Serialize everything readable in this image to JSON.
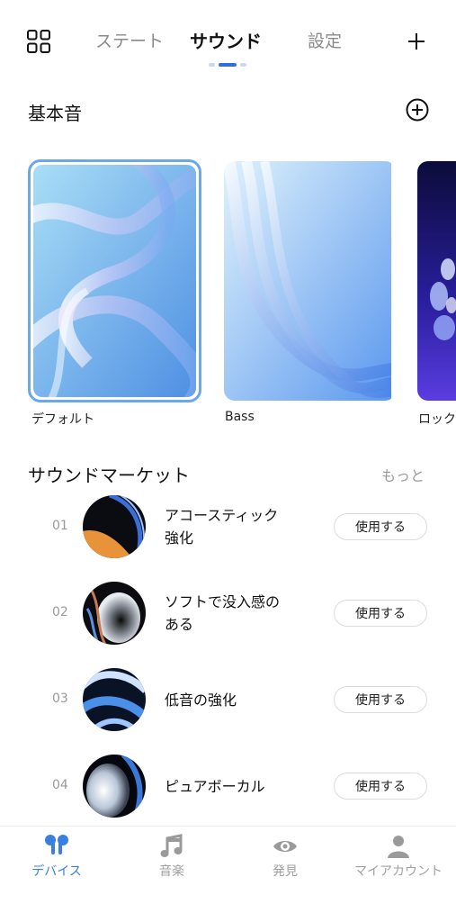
{
  "top_bar": {
    "tabs": [
      {
        "label": "ステート"
      },
      {
        "label": "サウンド"
      },
      {
        "label": "設定"
      }
    ]
  },
  "basic_sound": {
    "title": "基本音",
    "cards": [
      {
        "label": "デフォルト"
      },
      {
        "label": "Bass"
      },
      {
        "label": "ロック"
      }
    ]
  },
  "market": {
    "title": "サウンドマーケット",
    "more": "もっと",
    "items": [
      {
        "num": "01",
        "title_line1": "アコースティック",
        "title_line2": "強化",
        "button": "使用する"
      },
      {
        "num": "02",
        "title_line1": "ソフトで没入感の",
        "title_line2": "ある",
        "button": "使用する"
      },
      {
        "num": "03",
        "title_line1": "低音の強化",
        "title_line2": "",
        "button": "使用する"
      },
      {
        "num": "04",
        "title_line1": "ピュアボーカル",
        "title_line2": "",
        "button": "使用する"
      }
    ]
  },
  "bottom_nav": {
    "items": [
      {
        "label": "デバイス",
        "icon": "earbuds-icon"
      },
      {
        "label": "音楽",
        "icon": "music-note-icon"
      },
      {
        "label": "発見",
        "icon": "eye-icon"
      },
      {
        "label": "マイアカウント",
        "icon": "person-icon"
      }
    ]
  },
  "colors": {
    "accent": "#3a7ee0",
    "selected_border": "#6aa8e8"
  }
}
